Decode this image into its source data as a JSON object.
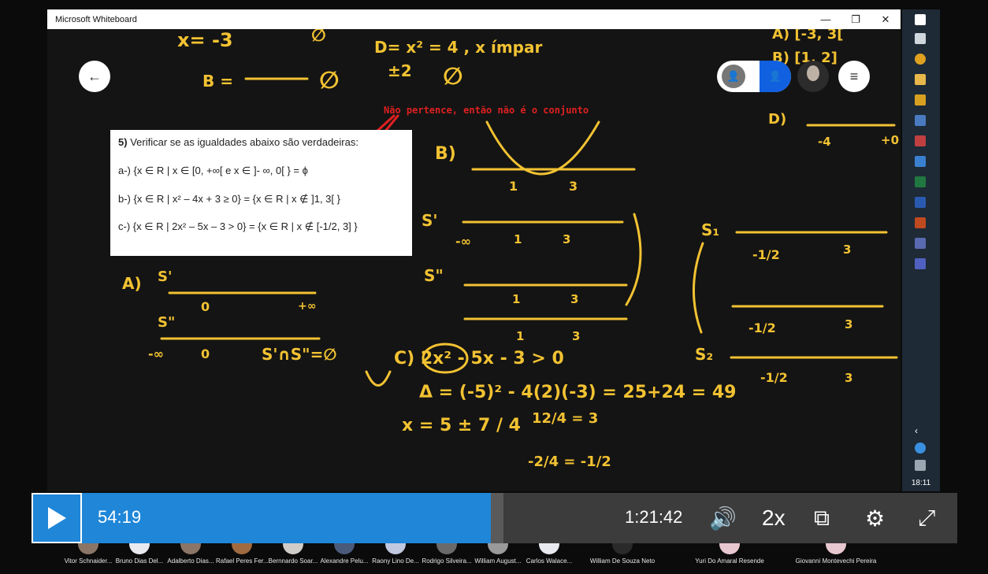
{
  "window": {
    "title": "Microsoft Whiteboard",
    "controls": {
      "minimize": "—",
      "restore": "❐",
      "close": "✕"
    }
  },
  "whiteboard": {
    "problem": {
      "heading_num": "5)",
      "heading": "Verificar se as igualdades abaixo são verdadeiras:",
      "items": [
        "a-) {x ∈ R | x ∈ [0, +∞[ e x ∈ ]- ∞, 0[ } = ϕ",
        "b-) {x ∈ R | x² – 4x + 3 ≥ 0} = {x ∈ R | x ∉ ]1, 3[ }",
        "c-) {x ∈ R | 2x² – 5x – 3 > 0} = {x ∈ R | x ∉ [-1/2, 3] }"
      ]
    },
    "note": "Não pertence, então não é o conjunto",
    "ink_text": {
      "b_eq": "B =",
      "x_eq": "x= -3",
      "d_eq": "D= x² = 4 , x ímpar",
      "pm2": "±2",
      "a_opt": "A) [-3, 3[",
      "b_opt": "B) [1, 2]",
      "d_opt": "D)",
      "B_label": "B)",
      "s1": "S'",
      "s2": "S\"",
      "A_label": "A)",
      "inter": "S'∩S\"=∅",
      "c_expr": "C) 2x² - 5x - 3 > 0",
      "delta": "Δ = (-5)² - 4(2)(-3) = 25+24 = 49",
      "x_frac": "x = 5 ± 7 / 4",
      "r1": "12/4 = 3",
      "r2": "-2/4 = -1/2",
      "S1": "S₁",
      "S2": "S₂",
      "minus_half": "-1/2",
      "three": "3",
      "one": "1",
      "minus_inf": "-∞",
      "plus_inf": "+∞",
      "zero": "0",
      "minus_four": "-4",
      "plus_zero": "+0",
      "empty": "∅"
    }
  },
  "player": {
    "current_time": "54:19",
    "total_time": "1:21:42",
    "speed": "2x",
    "progress": 0.665
  },
  "taskbar": {
    "time": "18:11"
  },
  "attendees": [
    "Vitor Schnaider...",
    "Bruno Dias Del...",
    "Adalberto Dias...",
    "Rafael Peres Fer...",
    "Bernnardo Soar...",
    "Alexandre Pelu...",
    "Raony Lino De...",
    "Rodrigo Silveira...",
    "William August...",
    "Carlos Walace...",
    "William De Souza Neto",
    "Yuri Do Amaral Resende",
    "Giovanni Montevechi Pereira"
  ],
  "colors": {
    "ink": "#f2c232",
    "note": "#e02020",
    "progress": "#1f86d8",
    "accent": "#1060e0"
  }
}
